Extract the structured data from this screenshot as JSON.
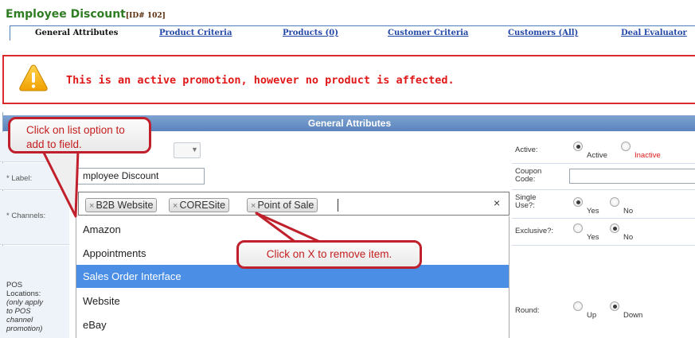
{
  "header": {
    "title": "Employee Discount",
    "id_tag": "[ID# 102]"
  },
  "tabs": [
    {
      "label": "General Attributes",
      "current": true
    },
    {
      "label": "Product Criteria",
      "current": false
    },
    {
      "label": "Products (0)",
      "current": false
    },
    {
      "label": "Customer Criteria",
      "current": false
    },
    {
      "label": "Customers (All)",
      "current": false
    },
    {
      "label": "Deal Evaluator",
      "current": false
    }
  ],
  "alert": {
    "message": "This is an active promotion, however no product is affected."
  },
  "panel": {
    "title": "General Attributes"
  },
  "form": {
    "label_label": "* Label:",
    "label_value": "mployee Discount",
    "channels_label": "* Channels:",
    "pos_label_lines": [
      "POS",
      "Locations:",
      "(only apply",
      "to POS",
      "channel",
      "promotion)"
    ],
    "channels_selected": [
      "B2B Website",
      "CORESite",
      "Point of Sale"
    ],
    "chip_remove": "×",
    "clear_all": "×",
    "channel_options": [
      "Amazon",
      "Appointments",
      "Sales Order Interface",
      "Website",
      "eBay"
    ],
    "highlighted_option": "Sales Order Interface"
  },
  "right": {
    "active_label": "Active:",
    "active_options": [
      "Active",
      "Inactive"
    ],
    "active_selected": "Active",
    "coupon_label_lines": [
      "Coupon",
      "Code:"
    ],
    "single_use_label_lines": [
      "Single",
      "Use?:"
    ],
    "single_use_options": [
      "Yes",
      "No"
    ],
    "single_use_selected": "Yes",
    "exclusive_label": "Exclusive?:",
    "exclusive_options": [
      "Yes",
      "No"
    ],
    "exclusive_selected": "No",
    "round_label": "Round:",
    "round_options": [
      "Up",
      "Down"
    ],
    "round_selected": "Down"
  },
  "callouts": {
    "list_option_lines": [
      "Click on list option to",
      "add to field."
    ],
    "remove_item": "Click on X to remove item."
  },
  "colors": {
    "title_green": "#2f7d23",
    "link_blue": "#2448a8",
    "alert_red": "#e01818",
    "panel_header": "#6890c6",
    "highlight": "#4a8ee6"
  },
  "icons": {
    "alert": "warning-triangle-icon",
    "dropdown": "chevron-down-icon",
    "remove": "x-icon"
  }
}
